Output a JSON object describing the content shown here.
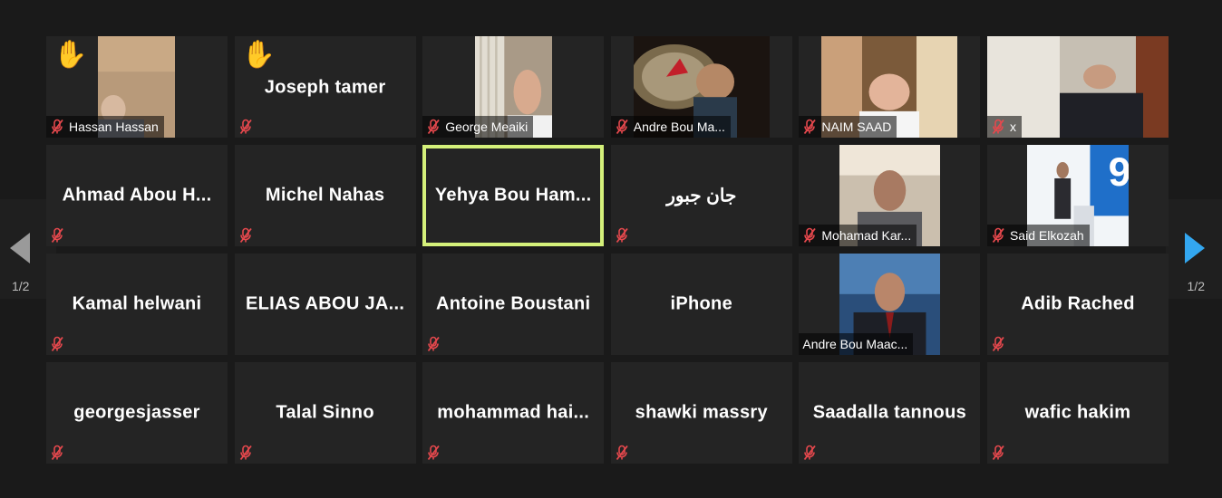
{
  "pager": {
    "label": "1/2"
  },
  "colors": {
    "active_border": "#d4f07a",
    "muted_icon": "#e5484d",
    "next_arrow": "#33a7f0",
    "prev_arrow": "#9a9a9a"
  },
  "tiles": [
    {
      "name": "Hassan Hassan",
      "display": "video",
      "muted": true,
      "hand": true
    },
    {
      "name": "Joseph tamer",
      "display": "name",
      "muted": true,
      "hand": true
    },
    {
      "name": "George Meaiki",
      "display": "video",
      "muted": true
    },
    {
      "name": "Andre Bou Ma...",
      "display": "video",
      "muted": true
    },
    {
      "name": "NAIM SAAD",
      "display": "video",
      "muted": true
    },
    {
      "name": "x",
      "display": "video",
      "muted": true
    },
    {
      "name": "Ahmad Abou H...",
      "display": "name",
      "muted": true
    },
    {
      "name": "Michel Nahas",
      "display": "name",
      "muted": true
    },
    {
      "name": "Yehya Bou Ham...",
      "display": "name",
      "muted": false,
      "active": true
    },
    {
      "name": "جان جبور",
      "display": "name",
      "muted": true
    },
    {
      "name": "Mohamad Kar...",
      "display": "video",
      "muted": true
    },
    {
      "name": "Said Elkozah",
      "display": "video",
      "muted": true
    },
    {
      "name": "Kamal helwani",
      "display": "name",
      "muted": true
    },
    {
      "name": "ELIAS ABOU JA...",
      "display": "name",
      "muted": false
    },
    {
      "name": "Antoine Boustani",
      "display": "name",
      "muted": true
    },
    {
      "name": "iPhone",
      "display": "name",
      "muted": false
    },
    {
      "name": "Andre Bou Maac...",
      "display": "video",
      "muted": false
    },
    {
      "name": "Adib Rached",
      "display": "name",
      "muted": true
    },
    {
      "name": "georgesjasser",
      "display": "name",
      "muted": true
    },
    {
      "name": "Talal Sinno",
      "display": "name",
      "muted": true
    },
    {
      "name": "mohammad hai...",
      "display": "name",
      "muted": true
    },
    {
      "name": "shawki massry",
      "display": "name",
      "muted": true
    },
    {
      "name": "Saadalla tannous",
      "display": "name",
      "muted": true
    },
    {
      "name": "wafic hakim",
      "display": "name",
      "muted": true
    }
  ]
}
